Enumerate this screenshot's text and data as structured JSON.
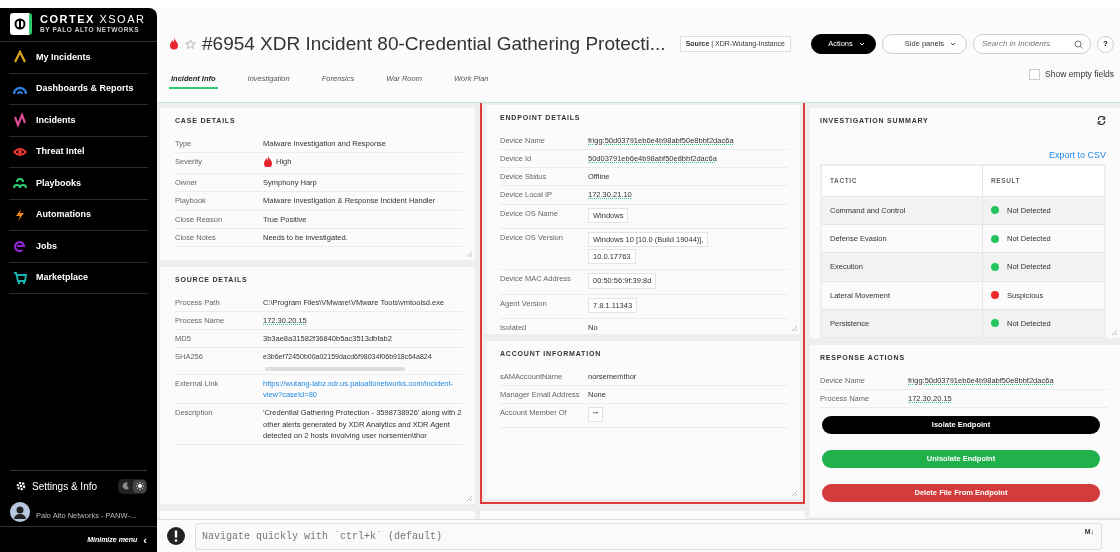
{
  "sidebar": {
    "brand": "CORTEX",
    "brand_product": "XSOAR",
    "brand_sub": "BY PALO ALTO NETWORKS",
    "items": [
      {
        "label": "My Incidents",
        "selected": false
      },
      {
        "label": "Dashboards & Reports",
        "selected": false
      },
      {
        "label": "Incidents",
        "selected": false
      },
      {
        "label": "Threat Intel",
        "selected": false
      },
      {
        "label": "Playbooks",
        "selected": false
      },
      {
        "label": "Automations",
        "selected": false
      },
      {
        "label": "Jobs",
        "selected": false
      },
      {
        "label": "Marketplace",
        "selected": false
      }
    ],
    "settings": "Settings & Info",
    "theme_dark": false,
    "user": "Palo Alto Networks - PANW-...",
    "minimize": "Minimize menu",
    "minimize_glyph": "‹"
  },
  "header": {
    "title": "#6954 XDR Incident 80-Credential Gathering Protecti...",
    "starred": false,
    "source": "**Source** | XDR-Wutang-Instance",
    "actions": "Actions",
    "side_panels": "Side panels",
    "search": {
      "placeholder": "Search in Incidents"
    },
    "help": "?",
    "tabs": [
      {
        "label": "Incident Info",
        "selected": true
      },
      {
        "label": "Investigation",
        "selected": false
      },
      {
        "label": "Forensics",
        "selected": false
      },
      {
        "label": "War Room",
        "selected": false
      },
      {
        "label": "Work Plan",
        "selected": false
      }
    ],
    "show_empty_fields": {
      "label": "Show empty fields",
      "checked": false
    }
  },
  "case_details": {
    "title": "CASE DETAILS",
    "fields": [
      {
        "label": "Type",
        "kind": "text",
        "value": "Malware Investigation and Response"
      },
      {
        "label": "Severity",
        "kind": "severity",
        "value": "High"
      },
      {
        "label": "Owner",
        "kind": "text",
        "value": "Symphony Harp"
      },
      {
        "label": "Playbook",
        "kind": "text",
        "value": "Malware Investigation & Response Incident Handler"
      },
      {
        "label": "Close Reason",
        "kind": "text",
        "value": "True Positive"
      },
      {
        "label": "Close Notes",
        "kind": "text",
        "value": "Needs to be investigated."
      }
    ]
  },
  "source_details": {
    "title": "SOURCE DETAILS",
    "fields": [
      {
        "label": "Process Path",
        "kind": "text",
        "value": "C:\\Program Files\\VMware\\VMware Tools\\vmtoolsd.exe"
      },
      {
        "label": "Process Name",
        "kind": "underline",
        "value": "172.30.20.15"
      },
      {
        "label": "MD5",
        "kind": "text",
        "value": "3b3ae8a31582f36840b5ac3513dbfab2"
      },
      {
        "label": "SHA256",
        "kind": "scroll",
        "value": "e3b6ef72450b00a02159dacd6f98034f06b918c64a824"
      },
      {
        "label": "External Link",
        "kind": "link",
        "value": "https://wutang-labz.xdr.us.paloaltonetworks.com/incident-view?caseId=80"
      },
      {
        "label": "Description",
        "kind": "text",
        "value": "'Credential Gathering Protection - 3598738926' along with 2 other alerts generated by XDR Analytics and XDR Agent detected on 2 hosts involving user norsemen\\thor"
      }
    ]
  },
  "endpoint_details": {
    "title": "ENDPOINT DETAILS",
    "highlighted": true,
    "fields": [
      {
        "label": "Device Name",
        "kind": "underline",
        "value": "frigg:50d03791eb6e4b98abf50e8bbf2dac6a"
      },
      {
        "label": "Device Id",
        "kind": "underline",
        "value": "50d03791eb6e4b98abf50e8bbf2dac6a"
      },
      {
        "label": "Device Status",
        "kind": "text",
        "value": "Offline"
      },
      {
        "label": "Device Local IP",
        "kind": "underline",
        "value": "172.30.21.10"
      },
      {
        "label": "Device OS Name",
        "kind": "chips",
        "chips": [
          "Windows"
        ]
      },
      {
        "label": "Device OS Version",
        "kind": "chips",
        "chips": [
          "Windows 10 [10.0 (Build 19044)],",
          "10.0.17763"
        ]
      },
      {
        "label": "Device MAC Address",
        "kind": "chips",
        "chips": [
          "00:50:56:9f:39:8d"
        ]
      },
      {
        "label": "Agent Version",
        "kind": "chips",
        "chips": [
          "7.8.1.11343"
        ]
      },
      {
        "label": "Isolated",
        "kind": "text",
        "value": "No"
      }
    ]
  },
  "account_information": {
    "title": "ACCOUNT INFORMATION",
    "fields": [
      {
        "label": "sAMAccountName",
        "kind": "text",
        "value": "norsemen\\thor"
      },
      {
        "label": "Manager Email Address",
        "kind": "text",
        "value": "None"
      },
      {
        "label": "Account Member Of",
        "kind": "chips",
        "chips": [
          "\"\""
        ]
      }
    ]
  },
  "investigation_summary": {
    "title": "INVESTIGATION SUMMARY",
    "export": "Export to CSV",
    "table": {
      "columns": [
        "TACTIC",
        "RESULT"
      ],
      "rows": [
        {
          "tactic": "Command and Control",
          "result": "Not Detected",
          "color": "#22c55e"
        },
        {
          "tactic": "Defense Evasion",
          "result": "Not Detected",
          "color": "#22c55e"
        },
        {
          "tactic": "Execution",
          "result": "Not Detected",
          "color": "#22c55e"
        },
        {
          "tactic": "Lateral Movement",
          "result": "Suspicious",
          "color": "#ef2b2b"
        },
        {
          "tactic": "Persistence",
          "result": "Not Detected",
          "color": "#22c55e"
        }
      ]
    }
  },
  "response_actions": {
    "title": "RESPONSE ACTIONS",
    "fields": [
      {
        "label": "Device Name",
        "kind": "underline",
        "value": "frigg:50d03791eb6e4b98abf50e8bbf2dac6a"
      },
      {
        "label": "Process Name",
        "kind": "underline",
        "value": "172.30.20.15"
      }
    ],
    "buttons": [
      {
        "label": "Isolate Endpoint",
        "kind": "dark"
      },
      {
        "label": "Unisolate Endpoint",
        "kind": "success"
      },
      {
        "label": "Delete File From Endpoint",
        "kind": "danger"
      }
    ]
  },
  "command_bar": {
    "placeholder": "Navigate quickly with `ctrl+k` (default)",
    "markdown": "M↓"
  }
}
